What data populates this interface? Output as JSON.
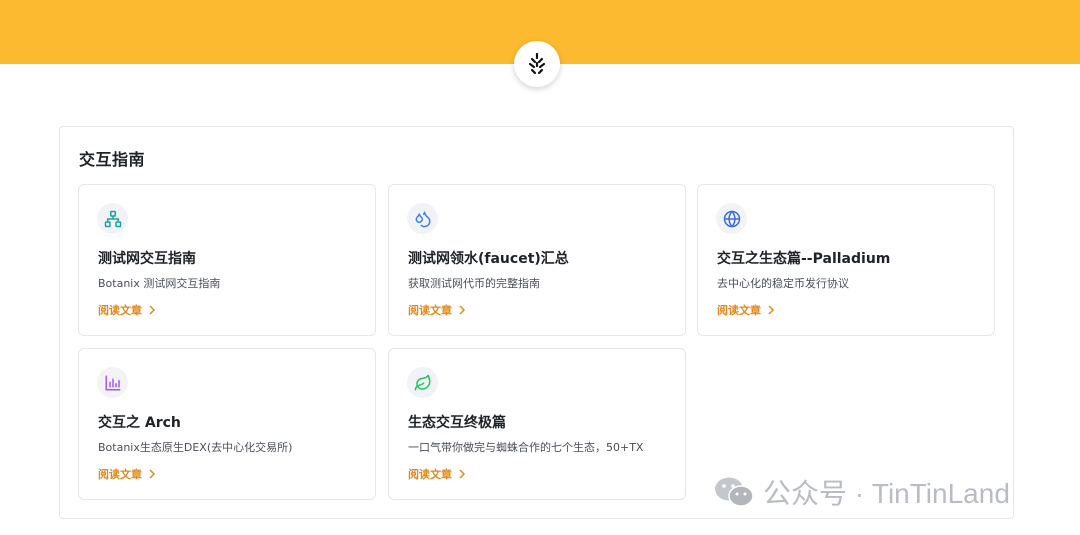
{
  "section": {
    "title": "交互指南"
  },
  "cards": [
    {
      "title": "测试网交互指南",
      "desc": "Botanix 测试网交互指南",
      "link": "阅读文章",
      "icon": "sitemap-icon",
      "icon_color": "#1aa39a"
    },
    {
      "title": "测试网领水(faucet)汇总",
      "desc": "获取测试网代币的完整指南",
      "link": "阅读文章",
      "icon": "droplets-icon",
      "icon_color": "#3b82f6"
    },
    {
      "title": "交互之生态篇--Palladium",
      "desc": "去中心化的稳定币发行协议",
      "link": "阅读文章",
      "icon": "globe-icon",
      "icon_color": "#3b6fd8"
    },
    {
      "title": "交互之 Arch",
      "desc": "Botanix生态原生DEX(去中心化交易所)",
      "link": "阅读文章",
      "icon": "bar-chart-icon",
      "icon_color": "#a855f7"
    },
    {
      "title": "生态交互终极篇",
      "desc": "一口气带你做完与蜘蛛合作的七个生态，50+TX",
      "link": "阅读文章",
      "icon": "leaf-icon",
      "icon_color": "#22c55e"
    }
  ],
  "watermark": {
    "text": "公众号 · TinTinLand"
  },
  "colors": {
    "banner": "#fbba30",
    "link": "#e08a1e"
  }
}
